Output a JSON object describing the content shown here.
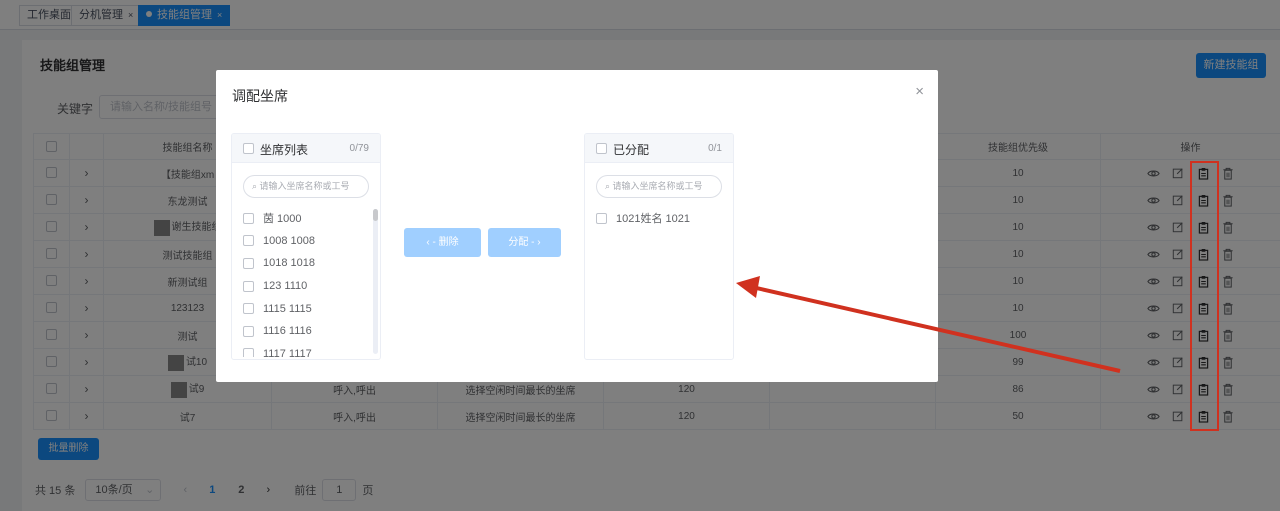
{
  "tabs": [
    {
      "label": "工作桌面"
    },
    {
      "label": "分机管理",
      "close": "×"
    },
    {
      "label": "技能组管理",
      "close": "×"
    }
  ],
  "page": {
    "title": "技能组管理",
    "new_button": "新建技能组",
    "keyword_label": "关键字",
    "keyword_placeholder": "请输入名称/技能组号"
  },
  "table": {
    "headers": [
      "技能组名称",
      "技能组优先级",
      "操作"
    ],
    "rows": [
      {
        "name": "【技能组xm",
        "priority": "10"
      },
      {
        "name": "东龙测试",
        "priority": "10"
      },
      {
        "name": "谢生技能组",
        "priority": "10"
      },
      {
        "name": "测试技能组",
        "priority": "10"
      },
      {
        "name": "新测试组",
        "priority": "10"
      },
      {
        "name": "123123",
        "priority": "10"
      },
      {
        "name": "测试",
        "priority": "100"
      },
      {
        "name": "试10",
        "priority": "99"
      },
      {
        "name": "试9",
        "type": "呼入,呼出",
        "strategy": "选择空闲时间最长的坐席",
        "timeout": "120",
        "priority": "86"
      },
      {
        "name": "试7",
        "type": "呼入,呼出",
        "strategy": "选择空闲时间最长的坐席",
        "timeout": "120",
        "priority": "50"
      }
    ]
  },
  "batch_delete": "批量删除",
  "pager": {
    "total": "共 15 条",
    "page_size": "10条/页",
    "prev": "‹",
    "pages": [
      "1",
      "2"
    ],
    "next": "›",
    "goto_label": "前往",
    "goto_value": "1",
    "goto_suffix": "页"
  },
  "modal": {
    "title": "调配坐席",
    "close": "×",
    "left": {
      "title": "坐席列表",
      "count": "0/79",
      "search_placeholder": "请输入坐席名称或工号",
      "items": [
        "茵 1000",
        "1008 1008",
        "1018 1018",
        "123 1110",
        "1115 1115",
        "1116 1116",
        "1117 1117"
      ]
    },
    "right": {
      "title": "已分配",
      "count": "0/1",
      "search_placeholder": "请输入坐席名称或工号",
      "items": [
        "1021姓名 1021"
      ]
    },
    "remove_button": "‹ - 删除",
    "assign_button": "分配 - ›"
  },
  "colors": {
    "accent": "#1890ff",
    "annotation": "#d0311f",
    "disabled_button": "#a0cfff"
  }
}
